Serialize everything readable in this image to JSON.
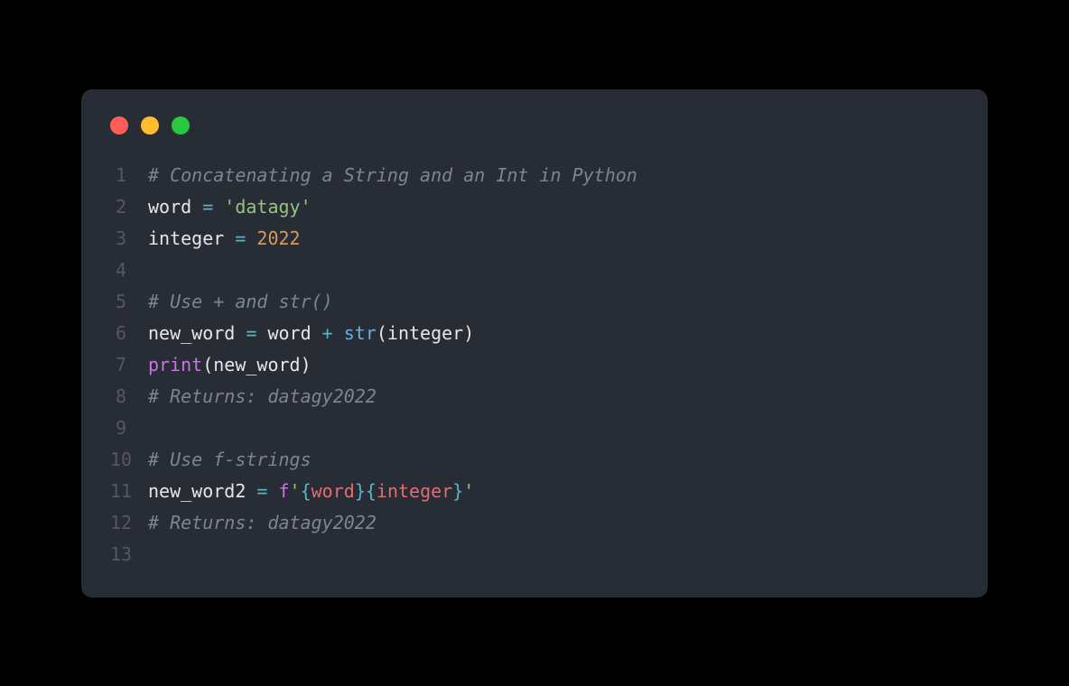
{
  "window": {
    "traffic_lights": [
      "close",
      "minimize",
      "maximize"
    ]
  },
  "lines": {
    "n1": "1",
    "n2": "2",
    "n3": "3",
    "n4": "4",
    "n5": "5",
    "n6": "6",
    "n7": "7",
    "n8": "8",
    "n9": "9",
    "n10": "10",
    "n11": "11",
    "n12": "12",
    "n13": "13"
  },
  "code": {
    "l1_comment": "# Concatenating a String and an Int in Python",
    "l2_var": "word",
    "l2_eq": " = ",
    "l2_str": "'datagy'",
    "l3_var": "integer",
    "l3_eq": " = ",
    "l3_num": "2022",
    "l5_comment": "# Use + and str()",
    "l6_var1": "new_word",
    "l6_eq": " = ",
    "l6_var2": "word",
    "l6_plus": " + ",
    "l6_func": "str",
    "l6_open": "(",
    "l6_arg": "integer",
    "l6_close": ")",
    "l7_func": "print",
    "l7_open": "(",
    "l7_arg": "new_word",
    "l7_close": ")",
    "l8_comment": "# Returns: datagy2022",
    "l10_comment": "# Use f-strings",
    "l11_var": "new_word2",
    "l11_eq": " = ",
    "l11_f": "f",
    "l11_q1": "'",
    "l11_ob1": "{",
    "l11_v1": "word",
    "l11_cb1": "}",
    "l11_ob2": "{",
    "l11_v2": "integer",
    "l11_cb2": "}",
    "l11_q2": "'",
    "l12_comment": "# Returns: datagy2022"
  }
}
